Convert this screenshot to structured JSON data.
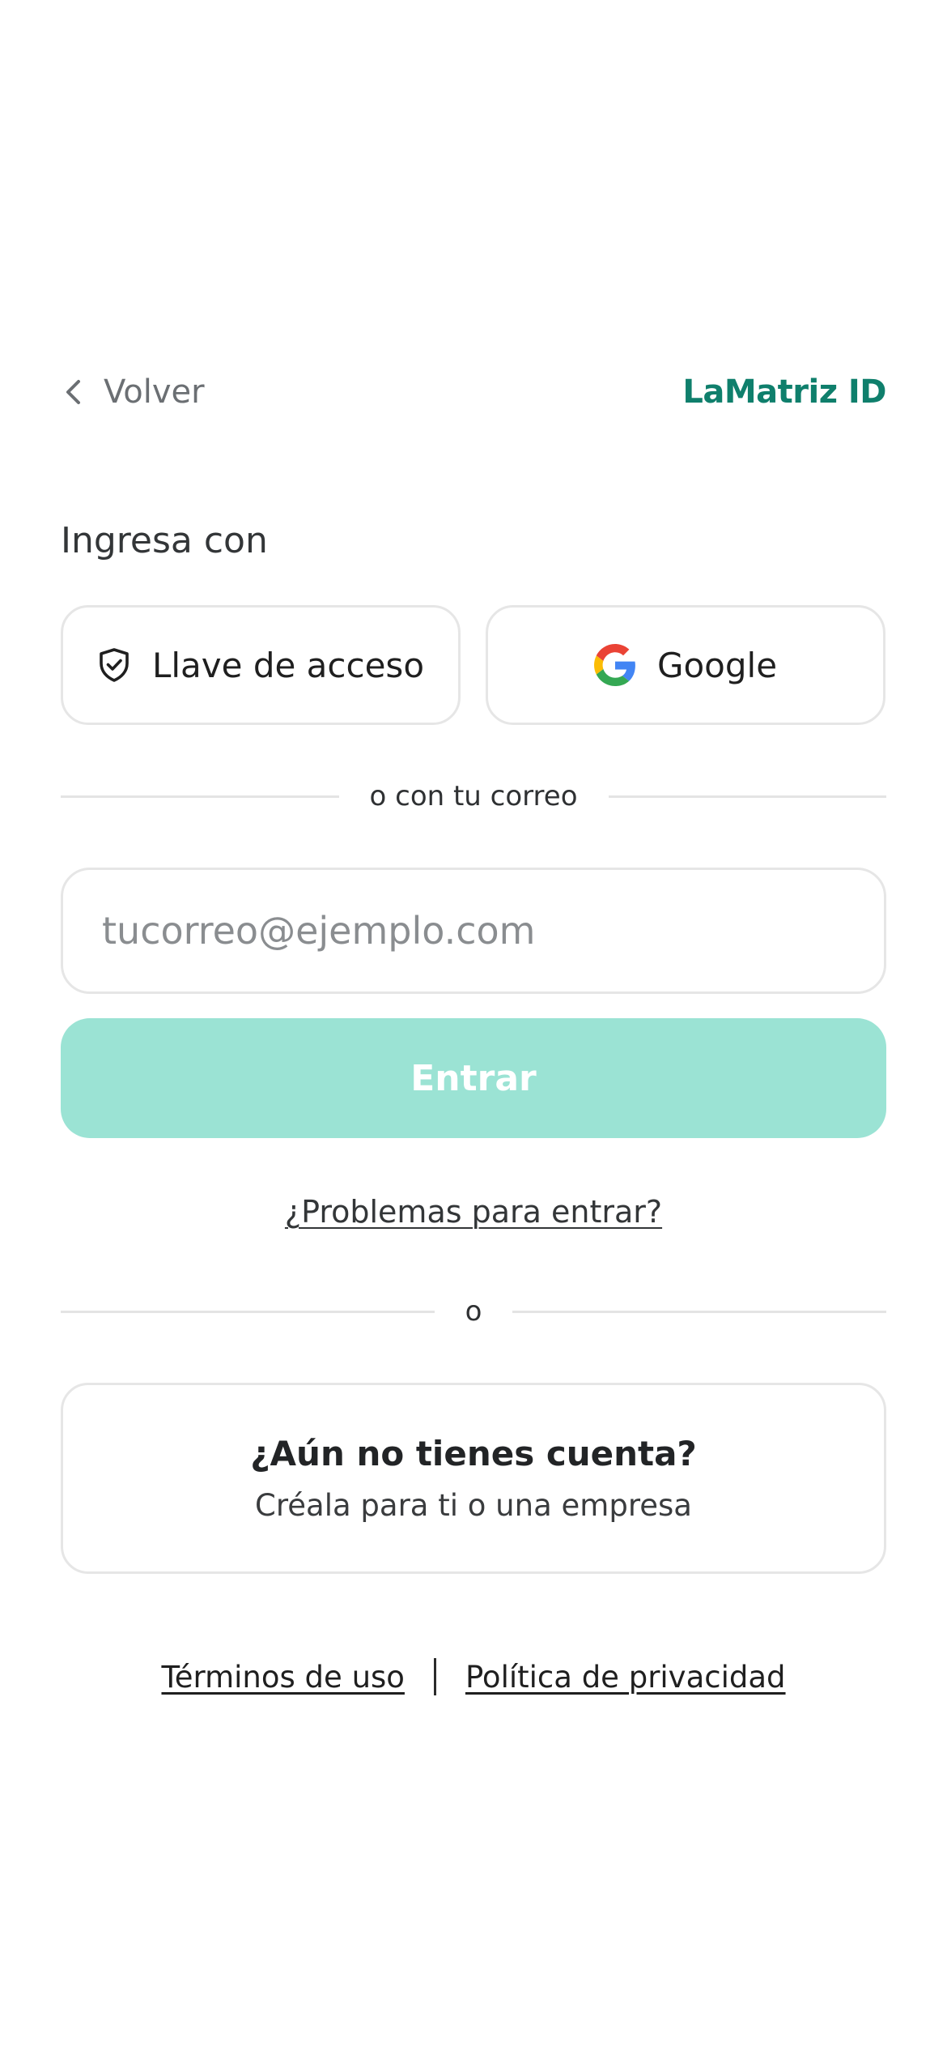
{
  "header": {
    "back_label": "Volver",
    "back_icon": "chevron-left-icon",
    "brand": "LaMatriz ID"
  },
  "login": {
    "heading": "Ingresa con",
    "passkey_label": "Llave de acceso",
    "passkey_icon": "shield-check-icon",
    "google_label": "Google",
    "google_icon": "google-logo-icon",
    "email_divider": "o con tu correo",
    "email_placeholder": "tucorreo@ejemplo.com",
    "email_value": "",
    "submit_label": "Entrar",
    "help_link": "¿Problemas para entrar?"
  },
  "or_divider": "o",
  "signup": {
    "title": "¿Aún no tienes cuenta?",
    "subtitle": "Créala para ti o una empresa"
  },
  "footer": {
    "terms": "Términos de uso",
    "privacy": "Política de privacidad"
  },
  "colors": {
    "brand": "#0f7f6c",
    "submit_disabled": "#9be3d4",
    "border": "#e6e6e6",
    "muted_text": "#6b6f73"
  }
}
